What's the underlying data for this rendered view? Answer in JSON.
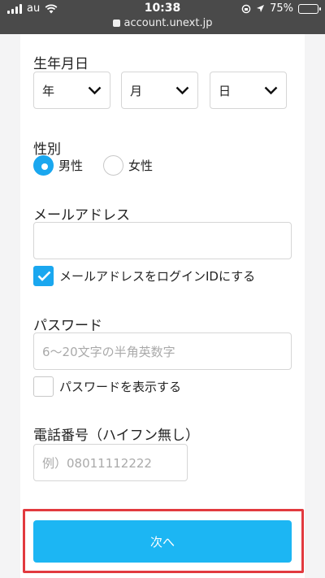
{
  "status_bar": {
    "carrier": "au",
    "time": "10:38",
    "url": "account.unext.jp",
    "battery": "75%",
    "battery_level": 0.75
  },
  "form": {
    "birthdate": {
      "label": "生年月日",
      "year_placeholder": "年",
      "month_placeholder": "月",
      "day_placeholder": "日"
    },
    "gender": {
      "label": "性別",
      "options": [
        "男性",
        "女性"
      ],
      "selected": "男性"
    },
    "email": {
      "label": "メールアドレス",
      "value": "",
      "use_as_login_label": "メールアドレスをログインIDにする",
      "use_as_login_checked": true
    },
    "password": {
      "label": "パスワード",
      "placeholder": "6〜20文字の半角英数字",
      "show_password_label": "パスワードを表示する",
      "show_password_checked": false
    },
    "phone": {
      "label": "電話番号（ハイフン無し）",
      "placeholder": "例）08011112222"
    },
    "next_button": "次へ"
  },
  "colors": {
    "accent": "#1aa7ef",
    "button": "#1cb6f3",
    "highlight": "#e23a3f"
  }
}
